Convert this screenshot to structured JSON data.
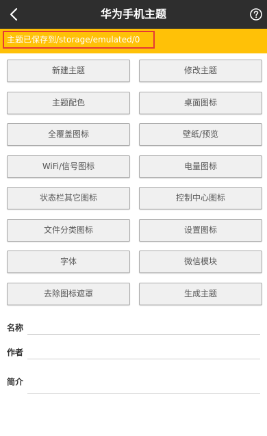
{
  "header": {
    "title": "华为手机主题",
    "back_icon": "chevron-left-icon",
    "help_icon": "question-circle-icon"
  },
  "notice": {
    "text": "主题已保存到/storage/emulated/0"
  },
  "buttons": [
    {
      "label": "新建主题"
    },
    {
      "label": "修改主题"
    },
    {
      "label": "主题配色"
    },
    {
      "label": "桌面图标"
    },
    {
      "label": "全覆盖图标"
    },
    {
      "label": "壁纸/预览"
    },
    {
      "label": "WiFi/信号图标"
    },
    {
      "label": "电量图标"
    },
    {
      "label": "状态栏其它图标"
    },
    {
      "label": "控制中心图标"
    },
    {
      "label": "文件分类图标"
    },
    {
      "label": "设置图标"
    },
    {
      "label": "字体"
    },
    {
      "label": "微信模块"
    },
    {
      "label": "去除图标遮罩"
    },
    {
      "label": "生成主题"
    }
  ],
  "form": {
    "name_label": "名称",
    "name_value": "",
    "author_label": "作者",
    "author_value": "",
    "intro_label": "简介",
    "intro_value": ""
  },
  "colors": {
    "topbar": "#2e2e2e",
    "notice": "#ffc107",
    "notice_border": "#e53935"
  }
}
